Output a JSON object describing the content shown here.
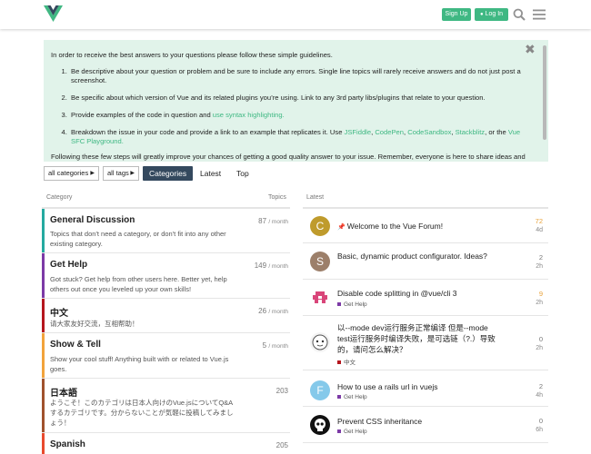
{
  "header": {
    "signup_label": "Sign Up",
    "login_label": "Log In",
    "brand_color": "#3fb883",
    "icons": [
      "vue-logo",
      "user-icon",
      "search-icon",
      "hamburger-menu-icon"
    ]
  },
  "banner": {
    "intro": "In order to receive the best answers to your questions please follow these simple guidelines.",
    "item1": "Be descriptive about your question or problem and be sure to include any errors. Single line topics will rarely receive answers and do not just post a screenshot.",
    "item2": "Be specific about which version of Vue and its related plugins you’re using. Link to any 3rd party libs/plugins that relate to your question.",
    "item3_text": "Provide examples of the code in question and ",
    "item3_link": "use syntax highlighting.",
    "item4_text": "Breakdown the issue in your code and provide a link to an example that replicates it. Use ",
    "item4_links": [
      "JSFiddle",
      "CodePen",
      "CodeSandbox",
      "Stackblitz"
    ],
    "item4_or": ", or the ",
    "item4_last": "Vue SFC Playground.",
    "outro": "Following these few steps will greatly improve your chances of getting a good quality answer to your issue. Remember, everyone is here to share ideas and to",
    "close_icon": "close-icon"
  },
  "nav": {
    "categories_dropdown": "all categories",
    "tags_dropdown": "all tags",
    "tabs": [
      "Categories",
      "Latest",
      "Top"
    ],
    "active_tab": "Categories"
  },
  "categories": {
    "header_category": "Category",
    "header_topics": "Topics",
    "per_month": "/ month",
    "items": [
      {
        "name": "General Discussion",
        "desc": "Topics that don't need a category, or don't fit into any other existing category.",
        "count": "87",
        "color": "#25aaa0"
      },
      {
        "name": "Get Help",
        "desc": "Got stuck? Get help from other users here. Better yet, help others out once you leveled up your own skills!",
        "count": "149",
        "color": "#7c3aa6"
      },
      {
        "name": "中文",
        "desc": "请大家友好交流，互相帮助！",
        "count": "26",
        "color": "#b5161e"
      },
      {
        "name": "Show & Tell",
        "desc": "Show your cool stuff! Anything built with or related to Vue.js goes.",
        "count": "5",
        "color": "#f2a33c"
      },
      {
        "name": "日本語",
        "desc": "ようこそ！このカテゴリは日本人向けのVue.jsについてQ&Aするカテゴリです。分からないことが気軽に投稿してみましょう！",
        "count": "203",
        "color": "#a0522d"
      },
      {
        "name": "Spanish",
        "desc": "",
        "count": "205",
        "color": "#e84a2e"
      }
    ]
  },
  "latest": {
    "header": "Latest",
    "topics": [
      {
        "title": "Welcome to the Vue Forum!",
        "pinned": true,
        "category": "",
        "replies": "72",
        "age": "4d",
        "avatar": "C",
        "avatar_color": "#bf9b2c",
        "hot": true
      },
      {
        "title": "Basic, dynamic product configurator. Ideas?",
        "pinned": false,
        "category": "",
        "replies": "2",
        "age": "2h",
        "avatar": "S",
        "avatar_color": "#9c7f6a",
        "hot": false
      },
      {
        "title": "Disable code splitting in @vue/cli 3",
        "pinned": false,
        "category": "Get Help",
        "replies": "9",
        "age": "2h",
        "avatar": "pixel-avatar",
        "avatar_color": "#d9467a",
        "hot": true
      },
      {
        "title": "以--mode dev运行服务正常编译 但是--mode test运行服务时编译失败，是可选链（?.）导致的，请问怎么解决？",
        "pinned": false,
        "category": "中文",
        "replies": "0",
        "age": "2h",
        "avatar": "cartoon-avatar",
        "avatar_color": "#ffffff",
        "hot": false
      },
      {
        "title": "How to use a rails url in vuejs",
        "pinned": false,
        "category": "Get Help",
        "replies": "2",
        "age": "4h",
        "avatar": "F",
        "avatar_color": "#85c9ea",
        "hot": false
      },
      {
        "title": "Prevent CSS inheritance",
        "pinned": false,
        "category": "Get Help",
        "replies": "0",
        "age": "6h",
        "avatar": "skull-avatar",
        "avatar_color": "#111111",
        "hot": false
      }
    ]
  }
}
